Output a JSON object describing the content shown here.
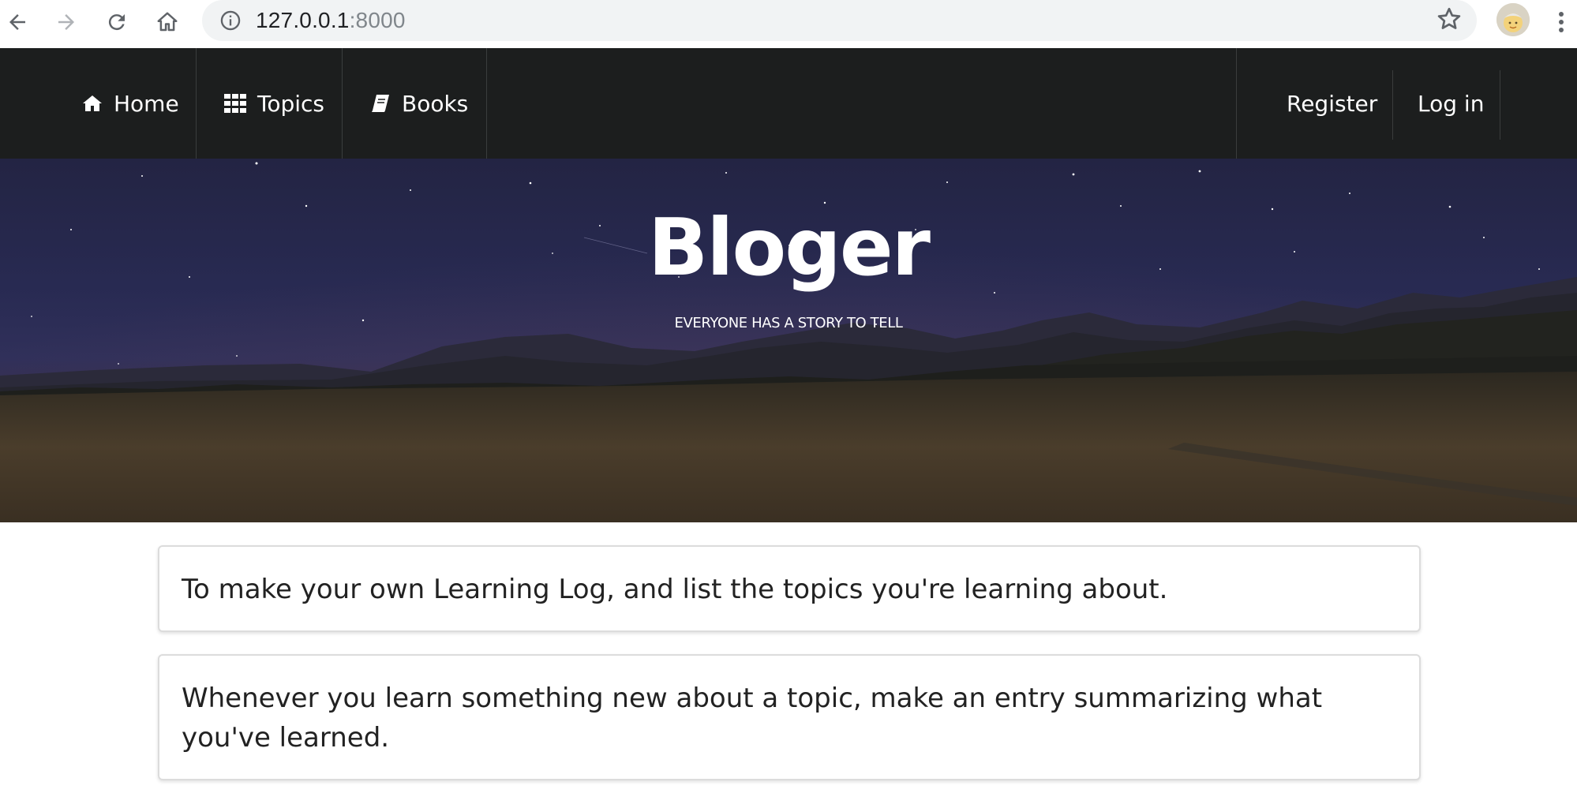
{
  "browser": {
    "url_host": "127.0.0.1",
    "url_port": ":8000",
    "icons": [
      "back-icon",
      "forward-icon",
      "reload-icon",
      "home-icon",
      "info-icon",
      "star-icon",
      "profile-avatar",
      "menu-icon"
    ]
  },
  "navbar": {
    "left_items": [
      {
        "label": "Home",
        "icon": "home-icon"
      },
      {
        "label": "Topics",
        "icon": "grid-icon"
      },
      {
        "label": "Books",
        "icon": "book-icon"
      }
    ],
    "right_items": [
      {
        "label": "Register"
      },
      {
        "label": "Log in"
      }
    ],
    "background": "#1c1e1e"
  },
  "hero": {
    "title": "Bloger",
    "subtitle": "EVERYONE HAS A STORY TO TELL"
  },
  "cards": [
    {
      "text": "To make your own Learning Log, and list the topics you're learning about."
    },
    {
      "text": "Whenever you learn something new about a topic, make an entry summarizing what you've learned."
    }
  ]
}
